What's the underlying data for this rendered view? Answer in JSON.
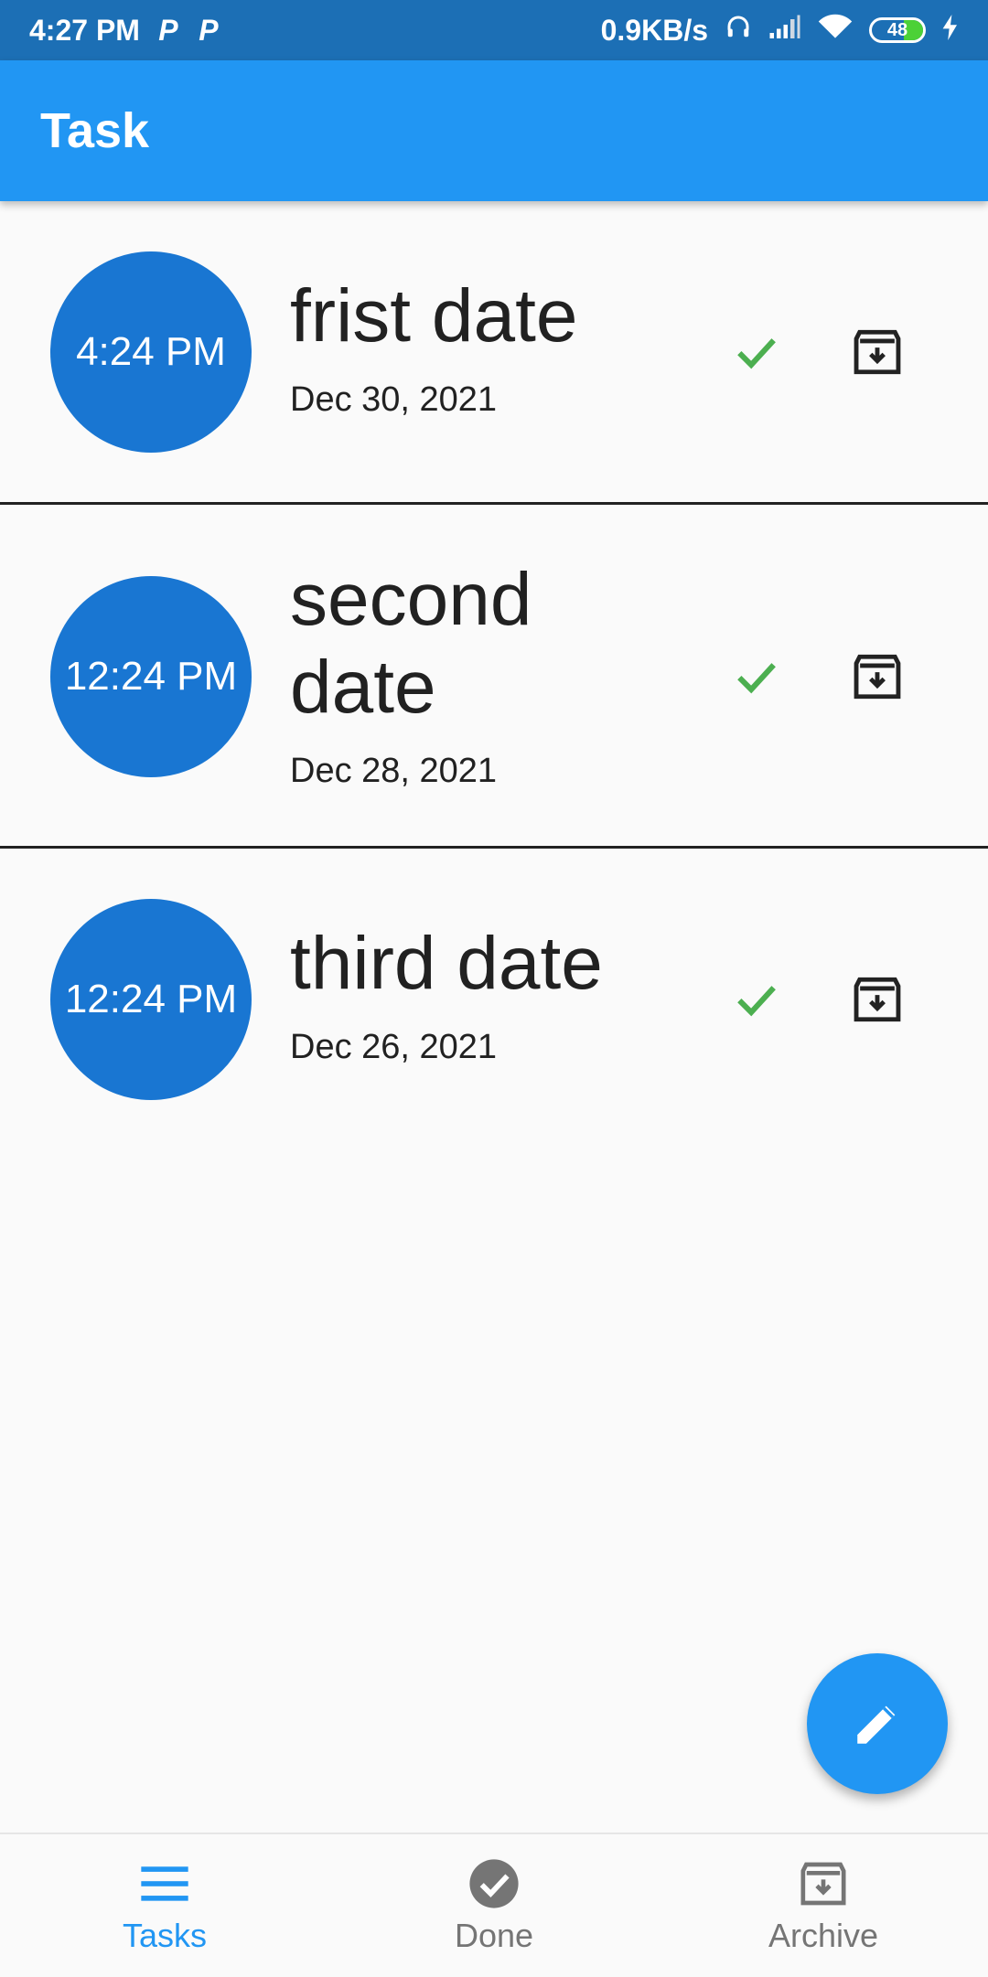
{
  "status_bar": {
    "time": "4:27 PM",
    "network_speed": "0.9KB/s",
    "battery_level": "48",
    "icons": [
      "p-notification-icon",
      "p-notification-icon",
      "headphones-icon",
      "signal-icon",
      "wifi-icon",
      "battery-icon",
      "charging-icon"
    ]
  },
  "app_bar": {
    "title": "Task"
  },
  "tasks": [
    {
      "time": "4:24 PM",
      "title_line1": "frist date",
      "title_line2": "",
      "date": "Dec 30, 2021"
    },
    {
      "time": "12:24 PM",
      "title_line1": "second",
      "title_line2": "date",
      "date": "Dec 28, 2021"
    },
    {
      "time": "12:24 PM",
      "title_line1": "third date",
      "title_line2": "",
      "date": "Dec 26, 2021"
    }
  ],
  "fab": {
    "icon": "edit-icon"
  },
  "bottom_nav": {
    "items": [
      {
        "label": "Tasks",
        "icon": "menu-icon",
        "active": true
      },
      {
        "label": "Done",
        "icon": "check-circle-icon",
        "active": false
      },
      {
        "label": "Archive",
        "icon": "archive-icon",
        "active": false
      }
    ]
  },
  "colors": {
    "status_bar": "#1c6fb5",
    "app_bar": "#2196f3",
    "time_circle": "#1976d2",
    "check": "#4caf50",
    "active_nav": "#2196f3",
    "inactive_nav": "#757575"
  }
}
